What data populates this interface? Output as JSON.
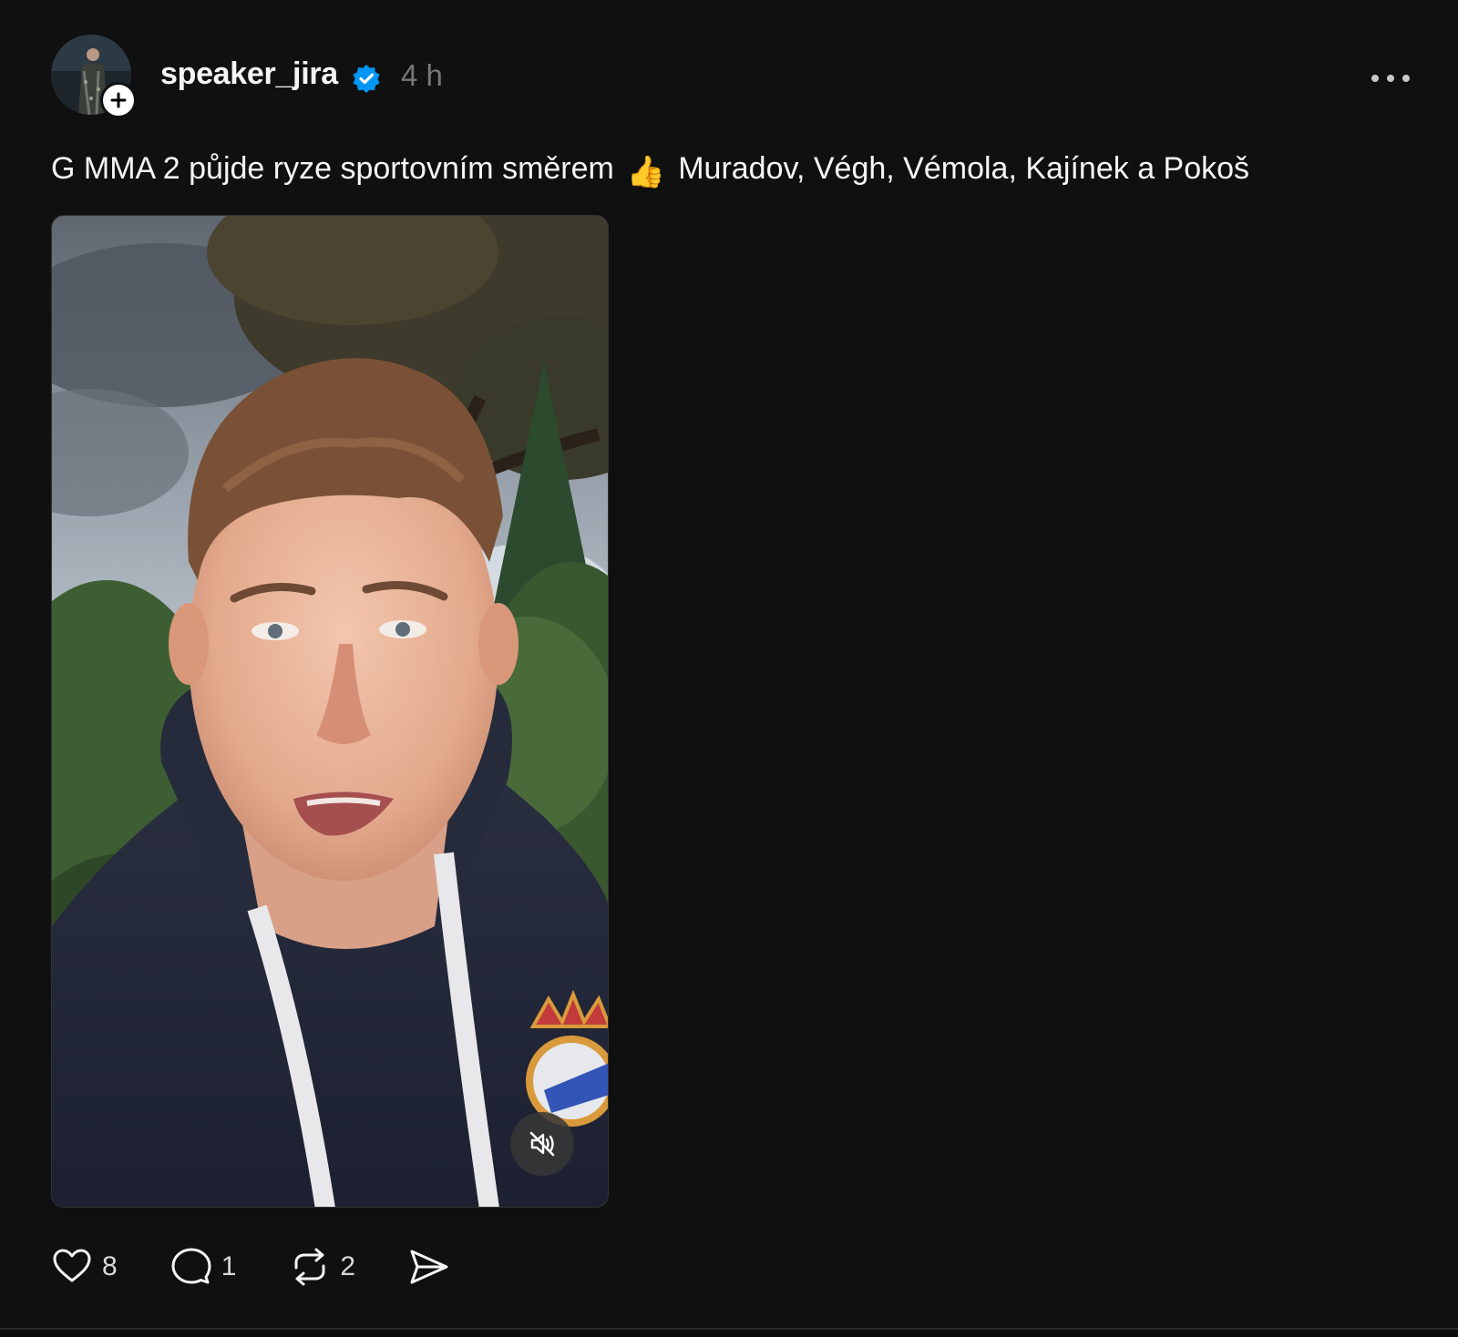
{
  "post": {
    "username": "speaker_jira",
    "timestamp": "4 h",
    "caption_before": "G MMA 2 půjde ryze sportovním směrem",
    "caption_emoji": "👍",
    "caption_after": "Muradov, Végh, Vémola, Kajínek a Pokoš",
    "verified": true
  },
  "actions": {
    "likes": "8",
    "replies": "1",
    "reposts": "2"
  },
  "icons": {
    "avatar_follow": "plus-icon",
    "verified": "verified-badge-icon",
    "more": "more-horizontal-icon",
    "mute": "speaker-muted-icon",
    "like": "heart-icon",
    "reply": "comment-icon",
    "repost": "repost-icon",
    "share": "send-icon"
  },
  "colors": {
    "background": "#101011",
    "text": "#f3f5f7",
    "muted_text": "#777777",
    "verified_blue": "#0095f6"
  },
  "media": {
    "kind": "video",
    "muted": true
  }
}
